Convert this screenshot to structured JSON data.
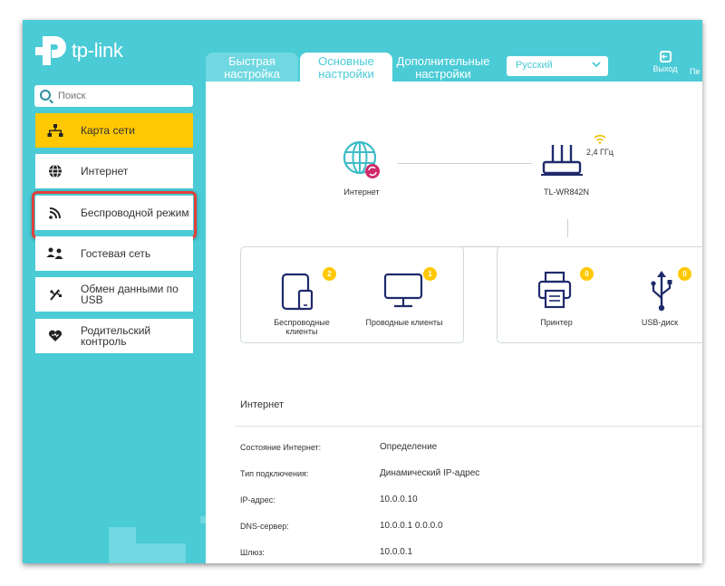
{
  "brand": {
    "name": "tp-link",
    "color": "#4acbd6",
    "accent": "#ffc800",
    "highlight": "#e0403a"
  },
  "tabs": [
    {
      "label": "Быстрая настройка",
      "line1": "Быстрая",
      "line2": "настройка"
    },
    {
      "label": "Основные настройки",
      "line1": "Основные",
      "line2": "настройки",
      "active": true
    },
    {
      "label": "Дополнительные настройки",
      "line1": "Дополнительные",
      "line2": "настройки"
    }
  ],
  "language": {
    "selected": "Русский"
  },
  "header": {
    "logout_label": "Выход",
    "next_label": "Пе"
  },
  "search": {
    "placeholder": "Поиск"
  },
  "sidebar": {
    "items": [
      {
        "label": "Карта сети",
        "icon": "network-map-icon",
        "active": true
      },
      {
        "label": "Интернет",
        "icon": "globe-icon"
      },
      {
        "label": "Беспроводной режим",
        "icon": "wifi-icon",
        "highlighted": true
      },
      {
        "label": "Гостевая сеть",
        "icon": "guest-icon"
      },
      {
        "label": "Обмен данными по USB",
        "line1": "Обмен данными по",
        "line2": "USB",
        "icon": "usb-share-icon"
      },
      {
        "label": "Родительский контроль",
        "line1": "Родительский",
        "line2": "контроль",
        "icon": "heart-icon"
      }
    ]
  },
  "map": {
    "internet_label": "Интернет",
    "router_label": "TL-WR842N",
    "band_label": "2,4 ГГц",
    "devices": [
      {
        "label": "Беспроводные клиенты",
        "line1": "Беспроводные",
        "line2": "клиенты",
        "count": "2",
        "icon": "wireless-clients-icon"
      },
      {
        "label": "Проводные клиенты",
        "count": "1",
        "icon": "monitor-icon"
      },
      {
        "label": "Принтер",
        "count": "0",
        "icon": "printer-icon"
      },
      {
        "label": "USB-диск",
        "count": "0",
        "icon": "usb-icon"
      }
    ]
  },
  "internet_info": {
    "title": "Интернет",
    "rows": [
      {
        "label": "Состояние Интернет:",
        "value": "Определение"
      },
      {
        "label": "Тип подключения:",
        "value": "Динамический IP-адрес"
      },
      {
        "label": "IP-адрес:",
        "value": "10.0.0.10"
      },
      {
        "label": "DNS-сервер:",
        "value": "10.0.0.1 0.0.0.0"
      },
      {
        "label": "Шлюз:",
        "value": "10.0.0.1"
      }
    ]
  }
}
